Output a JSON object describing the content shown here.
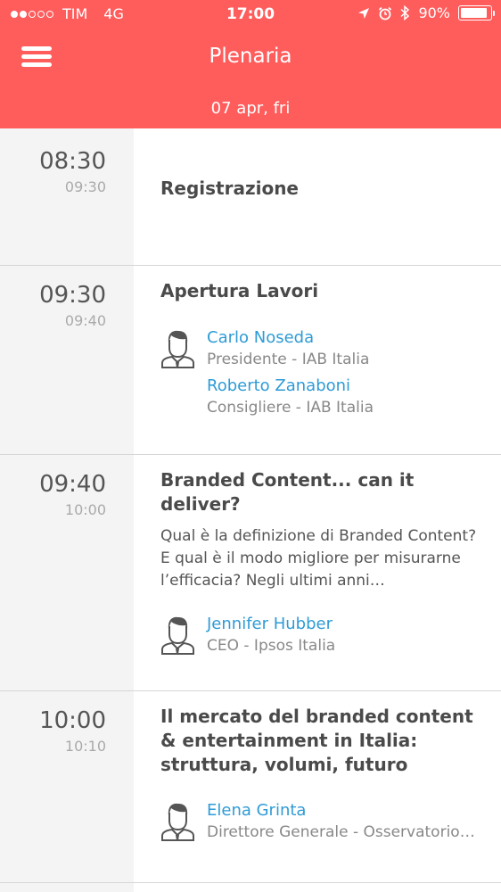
{
  "status_bar": {
    "carrier": "TIM",
    "network": "4G",
    "time": "17:00",
    "battery": "90%",
    "battery_level": 0.9,
    "signal_bars_filled": 2,
    "signal_bars_total": 5
  },
  "header": {
    "title": "Plenaria",
    "date": "07 apr, fri",
    "background_color": "#ff5c5c"
  },
  "sessions": [
    {
      "start": "08:30",
      "end": "09:30",
      "title": "Registrazione",
      "description": "",
      "speakers": []
    },
    {
      "start": "09:30",
      "end": "09:40",
      "title": "Apertura Lavori",
      "description": "",
      "speakers": [
        {
          "name": "Carlo Noseda",
          "role": "Presidente - IAB Italia"
        },
        {
          "name": "Roberto Zanaboni",
          "role": "Consigliere - IAB Italia"
        }
      ]
    },
    {
      "start": "09:40",
      "end": "10:00",
      "title": "Branded Content... can it deliver?",
      "description": "Qual è la definizione di Branded Content? E qual è il modo migliore per misurarne l’efficacia? Negli ultimi anni…",
      "speakers": [
        {
          "name": "Jennifer Hubber",
          "role": "CEO  - Ipsos Italia"
        }
      ]
    },
    {
      "start": "10:00",
      "end": "10:10",
      "title": "Il mercato del branded content & entertainment in Italia: struttura, volumi, futuro",
      "description": "",
      "speakers": [
        {
          "name": "Elena Grinta",
          "role": "Direttore Generale - Osservatorio…"
        }
      ]
    }
  ],
  "icons": {
    "menu": "hamburger-menu-icon",
    "avatar": "person-avatar-icon",
    "location": "location-arrow-icon",
    "alarm": "alarm-clock-icon",
    "bluetooth": "bluetooth-icon"
  },
  "colors": {
    "accent": "#ff5c5c",
    "link": "#2f9bd6",
    "time_column": "#f4f4f4"
  }
}
